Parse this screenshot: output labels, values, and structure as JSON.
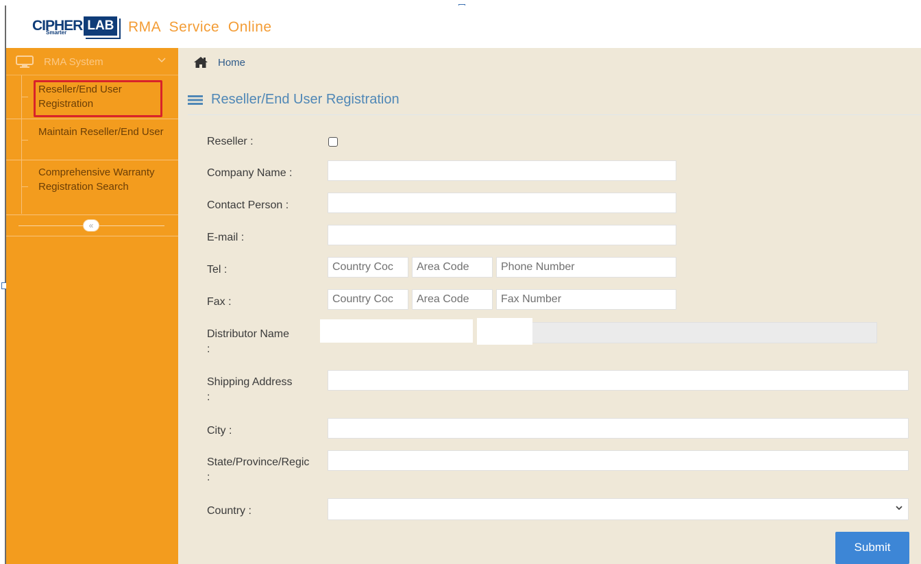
{
  "header": {
    "logo_cipher": "CIPHER",
    "logo_lab": "LAB",
    "logo_tagline": "Smarter",
    "app_title": "RMA  Service  Online"
  },
  "sidebar": {
    "section_label": "RMA System",
    "items": [
      {
        "label": "Reseller/End User Registration",
        "active": true
      },
      {
        "label": "Maintain Reseller/End User",
        "active": false
      },
      {
        "label": "Comprehensive Warranty Registration Search",
        "active": false
      }
    ],
    "collapse_glyph": "«"
  },
  "breadcrumb": {
    "home": "Home"
  },
  "page": {
    "title": "Reseller/End User Registration"
  },
  "form": {
    "reseller_label": "Reseller :",
    "reseller_checked": false,
    "company_name_label": "Company Name :",
    "company_name_value": "",
    "contact_person_label": "Contact Person :",
    "contact_person_value": "",
    "email_label": "E-mail :",
    "email_value": "",
    "tel_label": "Tel :",
    "tel_country_placeholder": "Country Coc",
    "tel_area_placeholder": "Area Code",
    "tel_phone_placeholder": "Phone Number",
    "fax_label": "Fax :",
    "fax_country_placeholder": "Country Coc",
    "fax_area_placeholder": "Area Code",
    "fax_number_placeholder": "Fax Number",
    "distributor_label": "Distributor Name\n:",
    "shipping_label": "Shipping Address\n:",
    "city_label": "City :",
    "state_label": "State/Province/Regic\n:",
    "country_label": "Country :",
    "country_value": "",
    "submit_label": "Submit"
  },
  "colors": {
    "sidebar_bg": "#f39c1e",
    "main_bg": "#efe8d8",
    "brand_blue": "#0f3c78",
    "title_orange": "#f39c35",
    "accent_blue": "#3d86d6",
    "active_outline": "#d8232a"
  },
  "icons": {
    "sidebar_head": "monitor-icon",
    "sidebar_chevron": "chevron-down-icon",
    "breadcrumb": "home-icon",
    "section": "list-icon",
    "country_select": "chevron-down-icon"
  }
}
